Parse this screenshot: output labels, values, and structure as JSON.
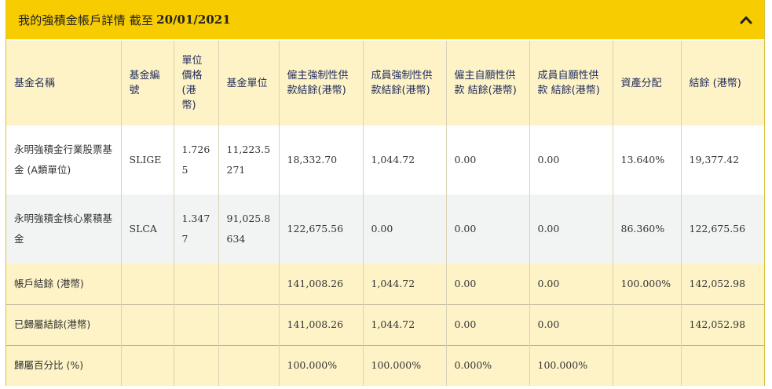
{
  "header": {
    "title": "我的強積金帳戶詳情 截至",
    "date": "20/01/2021",
    "collapse_icon": "chevron-up-icon"
  },
  "table": {
    "columns": [
      "基金名稱",
      "基金編號",
      "單位價格(港幣)",
      "基金單位",
      "僱主強制性供款結餘(港幣)",
      "成員強制性供款結餘(港幣)",
      "僱主自願性供款 結餘(港幣)",
      "成員自願性供款 結餘(港幣)",
      "資產分配",
      "結餘 (港幣)"
    ],
    "funds": [
      {
        "name": "永明強積金行業股票基金 (A類單位)",
        "code": "SLIGE",
        "unit_price": "1.7265",
        "units": "11,223.5271",
        "er_mandatory": "18,332.70",
        "ee_mandatory": "1,044.72",
        "er_voluntary": "0.00",
        "ee_voluntary": "0.00",
        "allocation": "13.640%",
        "balance": "19,377.42"
      },
      {
        "name": "永明強積金核心累積基金",
        "code": "SLCA",
        "unit_price": "1.3477",
        "units": "91,025.8634",
        "er_mandatory": "122,675.56",
        "ee_mandatory": "0.00",
        "er_voluntary": "0.00",
        "ee_voluntary": "0.00",
        "allocation": "86.360%",
        "balance": "122,675.56"
      }
    ],
    "summary": [
      {
        "label": "帳戶結餘 (港幣)",
        "er_mandatory": "141,008.26",
        "ee_mandatory": "1,044.72",
        "er_voluntary": "0.00",
        "ee_voluntary": "0.00",
        "allocation": "100.000%",
        "balance": "142,052.98"
      },
      {
        "label": "已歸屬結餘(港幣)",
        "er_mandatory": "141,008.26",
        "ee_mandatory": "1,044.72",
        "er_voluntary": "0.00",
        "ee_voluntary": "0.00",
        "allocation": "",
        "balance": "142,052.98"
      },
      {
        "label": "歸屬百分比 (%)",
        "er_mandatory": "100.000%",
        "ee_mandatory": "100.000%",
        "er_voluntary": "0.000%",
        "ee_voluntary": "100.000%",
        "allocation": "",
        "balance": ""
      }
    ]
  }
}
